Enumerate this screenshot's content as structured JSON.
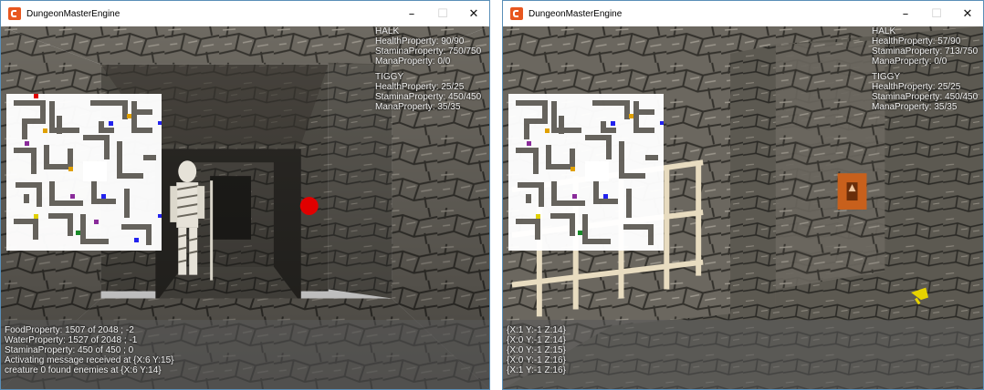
{
  "windows": [
    {
      "title": "DungeonMasterEngine",
      "controls": {
        "minimize": "–",
        "maximize": "☐",
        "close": "✕"
      },
      "champions": [
        {
          "name": "HALK",
          "health": "HealthProperty: 90/90",
          "stamina": "StaminaProperty: 750/750",
          "mana": "ManaProperty: 0/0"
        },
        {
          "name": "TIGGY",
          "health": "HealthProperty: 25/25",
          "stamina": "StaminaProperty: 450/450",
          "mana": "ManaProperty: 35/35"
        }
      ],
      "log": [
        "FoodProperty: 1507 of 2048 ; -2",
        "WaterProperty: 1527 of 2048 ; -1",
        "StaminaProperty: 450 of 450 ; 0",
        "Activating message received at {X:6 Y:15}",
        "creature 0 found enemies at {X:6 Y:14}"
      ]
    },
    {
      "title": "DungeonMasterEngine",
      "controls": {
        "minimize": "–",
        "maximize": "☐",
        "close": "✕"
      },
      "champions": [
        {
          "name": "HALK",
          "health": "HealthProperty: 57/90",
          "stamina": "StaminaProperty: 713/750",
          "mana": "ManaProperty: 0/0"
        },
        {
          "name": "TIGGY",
          "health": "HealthProperty: 25/25",
          "stamina": "StaminaProperty: 450/450",
          "mana": "ManaProperty: 35/35"
        }
      ],
      "log": [
        "{X:1 Y:-1 Z:14}",
        "{X:0 Y:-1 Z:14}",
        "{X:0 Y:-1 Z:15}",
        "{X:0 Y:-1 Z:16}",
        "{X:1 Y:-1 Z:16}"
      ]
    }
  ],
  "colors": {
    "stone": "#6e6a62",
    "stone_dark": "#3a3833",
    "hud_text": "#f2f2f2",
    "app_icon": "#e8571f",
    "enemy_marker": "#e00000",
    "gate_wood": "#e8dcc0",
    "wall_switch": "#c8601c"
  },
  "icons": {
    "app": "app-logo-icon",
    "key": "key-icon"
  }
}
